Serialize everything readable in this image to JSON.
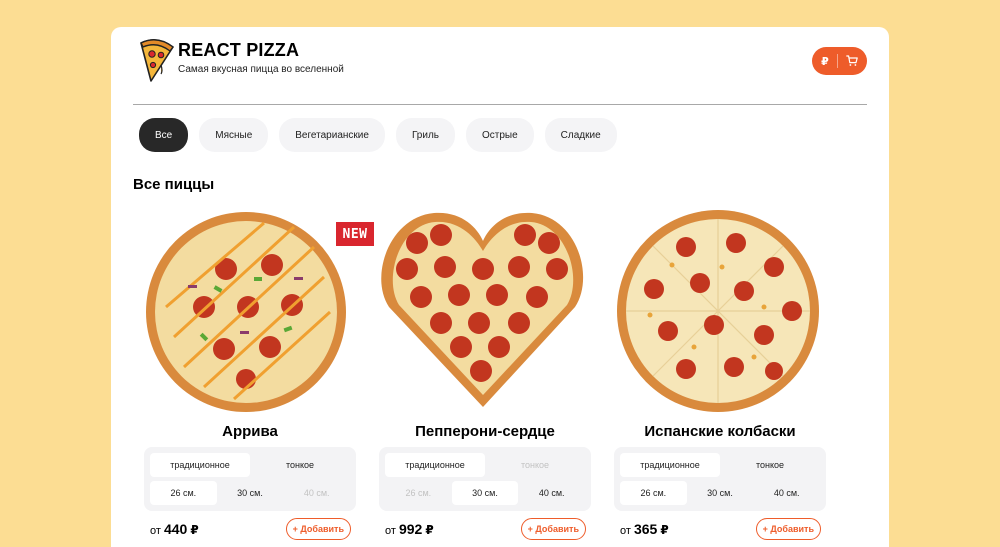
{
  "header": {
    "title": "REACT PIZZA",
    "subtitle": "Самая вкусная пицца во вселенной",
    "cart_currency": "₽",
    "logo_icon": "pizza-slice-icon",
    "cart_icon": "cart-icon"
  },
  "categories": [
    "Все",
    "Мясные",
    "Вегетарианские",
    "Гриль",
    "Острые",
    "Сладкие"
  ],
  "active_category": "Все",
  "section_title": "Все пиццы",
  "colors": {
    "background": "#fcdd93",
    "accent": "#ee5c2a",
    "active_category": "#282828",
    "new_badge": "#d9262e"
  },
  "pizzas": [
    {
      "name": "Аррива",
      "badge": "NEW",
      "doughs": [
        {
          "label": "традиционное",
          "state": "active"
        },
        {
          "label": "тонкое",
          "state": "normal"
        }
      ],
      "sizes": [
        {
          "label": "26 см.",
          "state": "active"
        },
        {
          "label": "30 см.",
          "state": "normal"
        },
        {
          "label": "40 см.",
          "state": "disabled"
        }
      ],
      "price_prefix": "от",
      "price": "440",
      "currency": "₽",
      "add_label": "+ Добавить"
    },
    {
      "name": "Пепперони-сердце",
      "doughs": [
        {
          "label": "традиционное",
          "state": "active"
        },
        {
          "label": "тонкое",
          "state": "disabled"
        }
      ],
      "sizes": [
        {
          "label": "26 см.",
          "state": "disabled"
        },
        {
          "label": "30 см.",
          "state": "active"
        },
        {
          "label": "40 см.",
          "state": "normal"
        }
      ],
      "price_prefix": "от",
      "price": "992",
      "currency": "₽",
      "add_label": "+ Добавить"
    },
    {
      "name": "Испанские колбаски",
      "doughs": [
        {
          "label": "традиционное",
          "state": "active"
        },
        {
          "label": "тонкое",
          "state": "normal"
        }
      ],
      "sizes": [
        {
          "label": "26 см.",
          "state": "active"
        },
        {
          "label": "30 см.",
          "state": "normal"
        },
        {
          "label": "40 см.",
          "state": "normal"
        }
      ],
      "price_prefix": "от",
      "price": "365",
      "currency": "₽",
      "add_label": "+ Добавить"
    }
  ]
}
